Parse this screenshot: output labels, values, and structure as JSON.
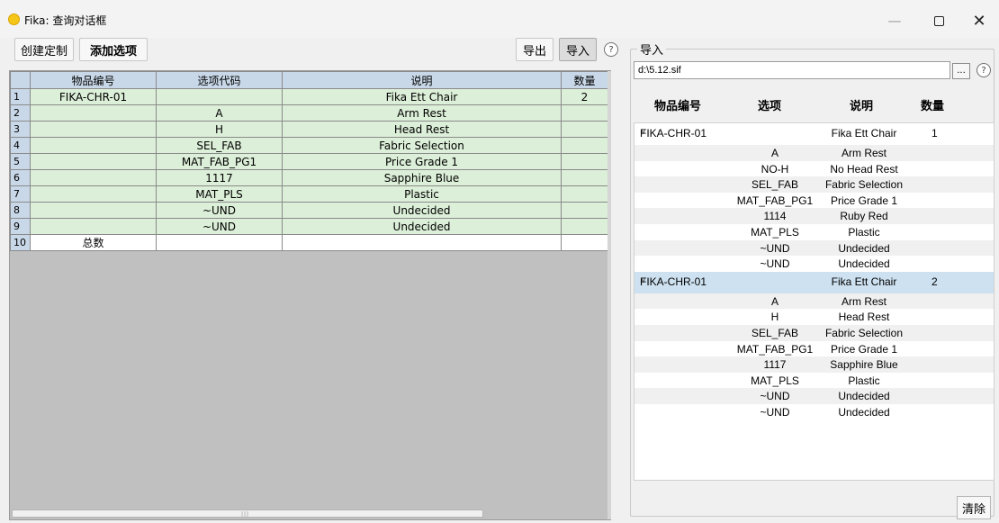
{
  "window": {
    "title": "Fika: 查询对话框",
    "minimize": "—",
    "close": "✕"
  },
  "toolbar": {
    "create_custom": "创建定制",
    "add_option": "添加选项",
    "export": "导出",
    "import": "导入",
    "help": "?"
  },
  "grid": {
    "columns": [
      "物品编号",
      "选项代码",
      "说明",
      "数量"
    ],
    "rows": [
      {
        "n": "1",
        "item": "FIKA-CHR-01",
        "code": "",
        "desc": "Fika Ett Chair",
        "qty": "2"
      },
      {
        "n": "2",
        "item": "",
        "code": "A",
        "desc": "Arm Rest",
        "qty": ""
      },
      {
        "n": "3",
        "item": "",
        "code": "H",
        "desc": "Head Rest",
        "qty": ""
      },
      {
        "n": "4",
        "item": "",
        "code": "SEL_FAB",
        "desc": "Fabric Selection",
        "qty": ""
      },
      {
        "n": "5",
        "item": "",
        "code": "MAT_FAB_PG1",
        "desc": "Price Grade 1",
        "qty": ""
      },
      {
        "n": "6",
        "item": "",
        "code": "1117",
        "desc": "Sapphire Blue",
        "qty": ""
      },
      {
        "n": "7",
        "item": "",
        "code": "MAT_PLS",
        "desc": "Plastic",
        "qty": ""
      },
      {
        "n": "8",
        "item": "",
        "code": "~UND",
        "desc": "Undecided",
        "qty": ""
      },
      {
        "n": "9",
        "item": "",
        "code": "~UND",
        "desc": "Undecided",
        "qty": ""
      },
      {
        "n": "10",
        "item": "总数",
        "code": "",
        "desc": "",
        "qty": ""
      }
    ]
  },
  "import_panel": {
    "legend": "导入",
    "path": "d:\\5.12.sif",
    "browse": "...",
    "help": "?",
    "headers": {
      "item": "物品编号",
      "option": "选项",
      "desc": "说明",
      "qty": "数量"
    },
    "groups": [
      {
        "item": "FIKA-CHR-01",
        "desc": "Fika Ett Chair",
        "qty": "1",
        "selected": false,
        "children": [
          {
            "code": "A",
            "desc": "Arm Rest"
          },
          {
            "code": "NO-H",
            "desc": "No Head Rest"
          },
          {
            "code": "SEL_FAB",
            "desc": "Fabric Selection"
          },
          {
            "code": "MAT_FAB_PG1",
            "desc": "Price Grade 1"
          },
          {
            "code": "1114",
            "desc": "Ruby Red"
          },
          {
            "code": "MAT_PLS",
            "desc": "Plastic"
          },
          {
            "code": "~UND",
            "desc": "Undecided"
          },
          {
            "code": "~UND",
            "desc": "Undecided"
          }
        ]
      },
      {
        "item": "FIKA-CHR-01",
        "desc": "Fika Ett Chair",
        "qty": "2",
        "selected": true,
        "children": [
          {
            "code": "A",
            "desc": "Arm Rest"
          },
          {
            "code": "H",
            "desc": "Head Rest"
          },
          {
            "code": "SEL_FAB",
            "desc": "Fabric Selection"
          },
          {
            "code": "MAT_FAB_PG1",
            "desc": "Price Grade 1"
          },
          {
            "code": "1117",
            "desc": "Sapphire Blue"
          },
          {
            "code": "MAT_PLS",
            "desc": "Plastic"
          },
          {
            "code": "~UND",
            "desc": "Undecided"
          },
          {
            "code": "~UND",
            "desc": "Undecided"
          }
        ]
      }
    ],
    "clear": "清除"
  }
}
